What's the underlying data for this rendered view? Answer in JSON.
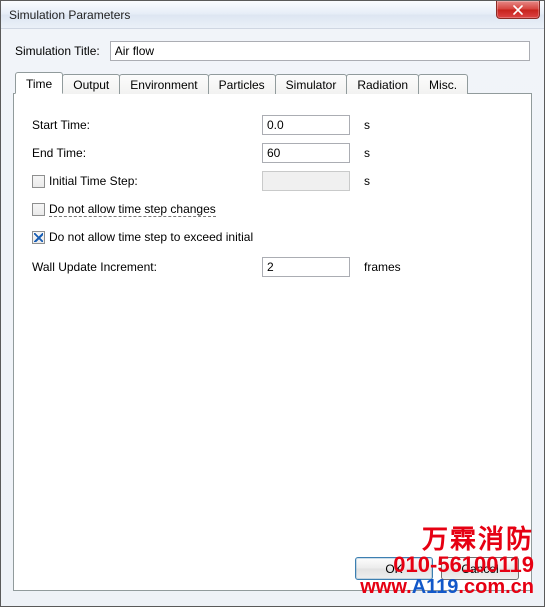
{
  "window": {
    "title": "Simulation Parameters"
  },
  "simTitle": {
    "label": "Simulation Title:",
    "value": "Air flow"
  },
  "tabs": {
    "items": [
      {
        "label": "Time"
      },
      {
        "label": "Output"
      },
      {
        "label": "Environment"
      },
      {
        "label": "Particles"
      },
      {
        "label": "Simulator"
      },
      {
        "label": "Radiation"
      },
      {
        "label": "Misc."
      }
    ],
    "activeIndex": 0
  },
  "time": {
    "startLabel": "Start Time:",
    "startValue": "0.0",
    "startUnit": "s",
    "endLabel": "End Time:",
    "endValue": "60",
    "endUnit": "s",
    "initialStepLabel": "Initial Time Step:",
    "initialStepValue": "",
    "initialStepUnit": "s",
    "initialStepChecked": false,
    "noChangesLabel": "Do not allow time step changes",
    "noChangesChecked": false,
    "noExceedLabel": "Do not allow time step to exceed initial",
    "noExceedChecked": true,
    "wallLabel": "Wall Update Increment:",
    "wallValue": "2",
    "wallUnit": "frames"
  },
  "buttons": {
    "ok": "OK",
    "cancel": "Cancel"
  },
  "watermark": {
    "l1": "万霖消防",
    "l2": "010-56100119",
    "l3a": "www.",
    "l3b": "A119",
    "l3c": ".com.cn"
  }
}
